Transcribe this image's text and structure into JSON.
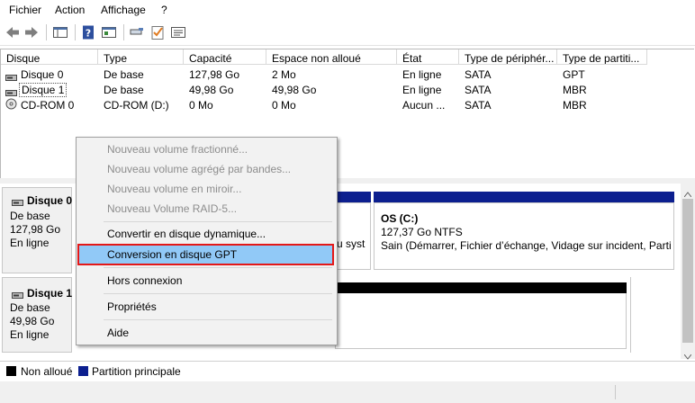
{
  "menu": {
    "items": [
      "Fichier",
      "Action",
      "Affichage",
      "?"
    ]
  },
  "toolbar": {
    "icons": [
      "back-arrow-icon",
      "forward-arrow-icon",
      "console-tree-icon",
      "help-icon",
      "properties-icon",
      "connect-icon",
      "checklist-icon",
      "details-icon"
    ]
  },
  "volumes": {
    "columns": [
      "Disque",
      "Type",
      "Capacité",
      "Espace non alloué",
      "État",
      "Type de périphér...",
      "Type de partiti..."
    ],
    "rows": [
      {
        "name": "Disque 0",
        "type": "De base",
        "capacity": "127,98 Go",
        "unallocated": "2 Mo",
        "state": "En ligne",
        "device": "SATA",
        "partition": "GPT"
      },
      {
        "name": "Disque 1",
        "type": "De base",
        "capacity": "49,98 Go",
        "unallocated": "49,98 Go",
        "state": "En ligne",
        "device": "SATA",
        "partition": "MBR"
      },
      {
        "name": "CD-ROM 0",
        "type": "CD-ROM (D:)",
        "capacity": "0 Mo",
        "unallocated": "0 Mo",
        "state": "Aucun ...",
        "device": "SATA",
        "partition": "MBR"
      }
    ]
  },
  "disks": [
    {
      "title": "Disque 0",
      "type": "De base",
      "size": "127,98 Go",
      "state": "En ligne",
      "partition_fragment": "u syst",
      "os_partition": {
        "title": "OS  (C:)",
        "size": "127,37 Go NTFS",
        "status": "Sain (Démarrer, Fichier d’échange, Vidage sur incident, Partiti"
      }
    },
    {
      "title": "Disque 1",
      "type": "De base",
      "size": "49,98 Go",
      "state": "En ligne"
    }
  ],
  "legend": {
    "unallocated": "Non alloué",
    "primary": "Partition principale",
    "colors": {
      "unallocated": "#000000",
      "primary": "#0c1f8f"
    }
  },
  "context_menu": {
    "items": [
      {
        "label": "Nouveau volume fractionné...",
        "enabled": false
      },
      {
        "label": "Nouveau volume agrégé par bandes...",
        "enabled": false
      },
      {
        "label": "Nouveau volume en miroir...",
        "enabled": false
      },
      {
        "label": "Nouveau Volume RAID-5...",
        "enabled": false
      },
      {
        "label": "Convertir en disque dynamique...",
        "enabled": true
      },
      {
        "label": "Conversion en disque GPT",
        "enabled": true,
        "highlighted": true
      },
      {
        "label": "Hors connexion",
        "enabled": true
      },
      {
        "label": "Propriétés",
        "enabled": true
      },
      {
        "label": "Aide",
        "enabled": true
      }
    ],
    "highlight_color": "#91c9f7",
    "highlight_border": "#e41818"
  }
}
